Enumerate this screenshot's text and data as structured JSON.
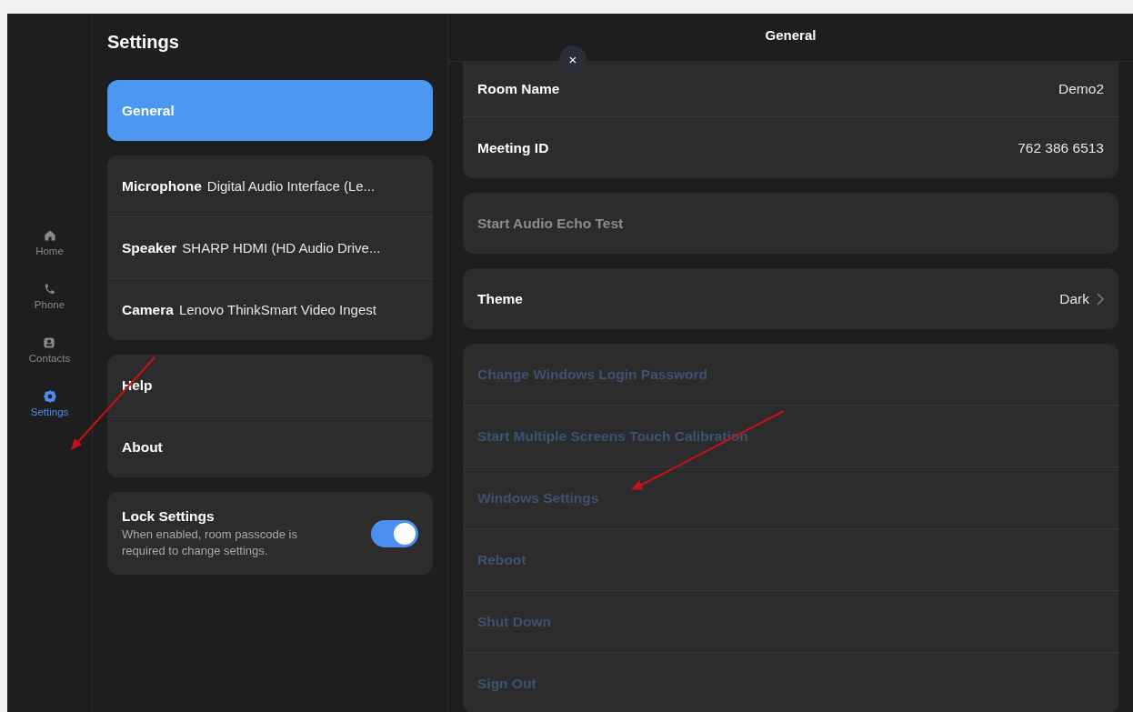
{
  "nav": [
    {
      "label": "Home",
      "kind": "home",
      "selected": false
    },
    {
      "label": "Phone",
      "kind": "phone",
      "selected": false
    },
    {
      "label": "Contacts",
      "kind": "contacts",
      "selected": false
    },
    {
      "label": "Settings",
      "kind": "gear",
      "selected": true
    }
  ],
  "settings": {
    "title": "Settings",
    "groups": [
      {
        "items": [
          {
            "label": "General",
            "selected": true
          }
        ]
      },
      {
        "items": [
          {
            "label": "Microphone",
            "value": "Digital Audio Interface (Le...",
            "selected": false
          },
          {
            "label": "Speaker",
            "value": "SHARP HDMI (HD Audio Drive...",
            "selected": false
          },
          {
            "label": "Camera",
            "value": "Lenovo ThinkSmart Video Ingest",
            "selected": false
          }
        ]
      },
      {
        "items": [
          {
            "label": "Help",
            "selected": false
          },
          {
            "label": "About",
            "selected": false
          }
        ]
      }
    ],
    "lock": {
      "title": "Lock Settings",
      "description": "When enabled, room passcode is required to change settings.",
      "on": true
    }
  },
  "detail": {
    "title": "General",
    "close": "×",
    "cards": [
      {
        "rows": [
          {
            "kind": "info",
            "label": "Room Name",
            "value": "Demo2"
          },
          {
            "kind": "info",
            "label": "Meeting ID",
            "value": "762 386 6513"
          }
        ]
      },
      {
        "rows": [
          {
            "kind": "action",
            "label": "Start Audio Echo Test"
          }
        ]
      },
      {
        "rows": [
          {
            "kind": "nav",
            "label": "Theme",
            "value": "Dark"
          }
        ]
      },
      {
        "rows": [
          {
            "kind": "link",
            "label": "Change Windows Login Password"
          },
          {
            "kind": "link",
            "label": "Start Multiple Screens Touch Calibration"
          },
          {
            "kind": "link",
            "label": "Windows Settings"
          },
          {
            "kind": "link",
            "label": "Reboot"
          },
          {
            "kind": "link",
            "label": "Shut Down"
          },
          {
            "kind": "link",
            "label": "Sign Out"
          }
        ]
      }
    ]
  }
}
